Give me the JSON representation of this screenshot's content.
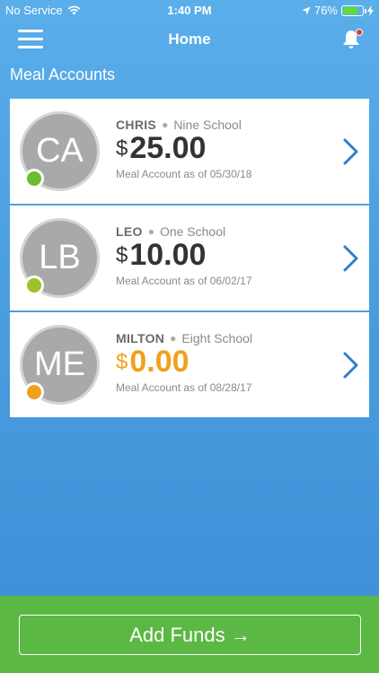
{
  "status_bar": {
    "carrier": "No Service",
    "time": "1:40 PM",
    "battery": "76%",
    "battery_level": 0.76
  },
  "nav": {
    "title": "Home"
  },
  "section_title": "Meal Accounts",
  "accounts": [
    {
      "initials": "CA",
      "name": "CHRIS",
      "school": "Nine School",
      "currency": "$",
      "balance": "25.00",
      "as_of": "Meal Account as of 05/30/18",
      "status_color": "#6dbb2e",
      "balance_color": "#333333"
    },
    {
      "initials": "LB",
      "name": "LEO",
      "school": "One School",
      "currency": "$",
      "balance": "10.00",
      "as_of": "Meal Account as of 06/02/17",
      "status_color": "#9bc22a",
      "balance_color": "#333333"
    },
    {
      "initials": "ME",
      "name": "MILTON",
      "school": "Eight School",
      "currency": "$",
      "balance": "0.00",
      "as_of": "Meal Account as of 08/28/17",
      "status_color": "#f0a11c",
      "balance_color": "#f0a11c"
    }
  ],
  "footer": {
    "add_funds_label": "Add Funds →"
  },
  "colors": {
    "accent": "#2f80c8",
    "footer_green": "#5cb844"
  }
}
